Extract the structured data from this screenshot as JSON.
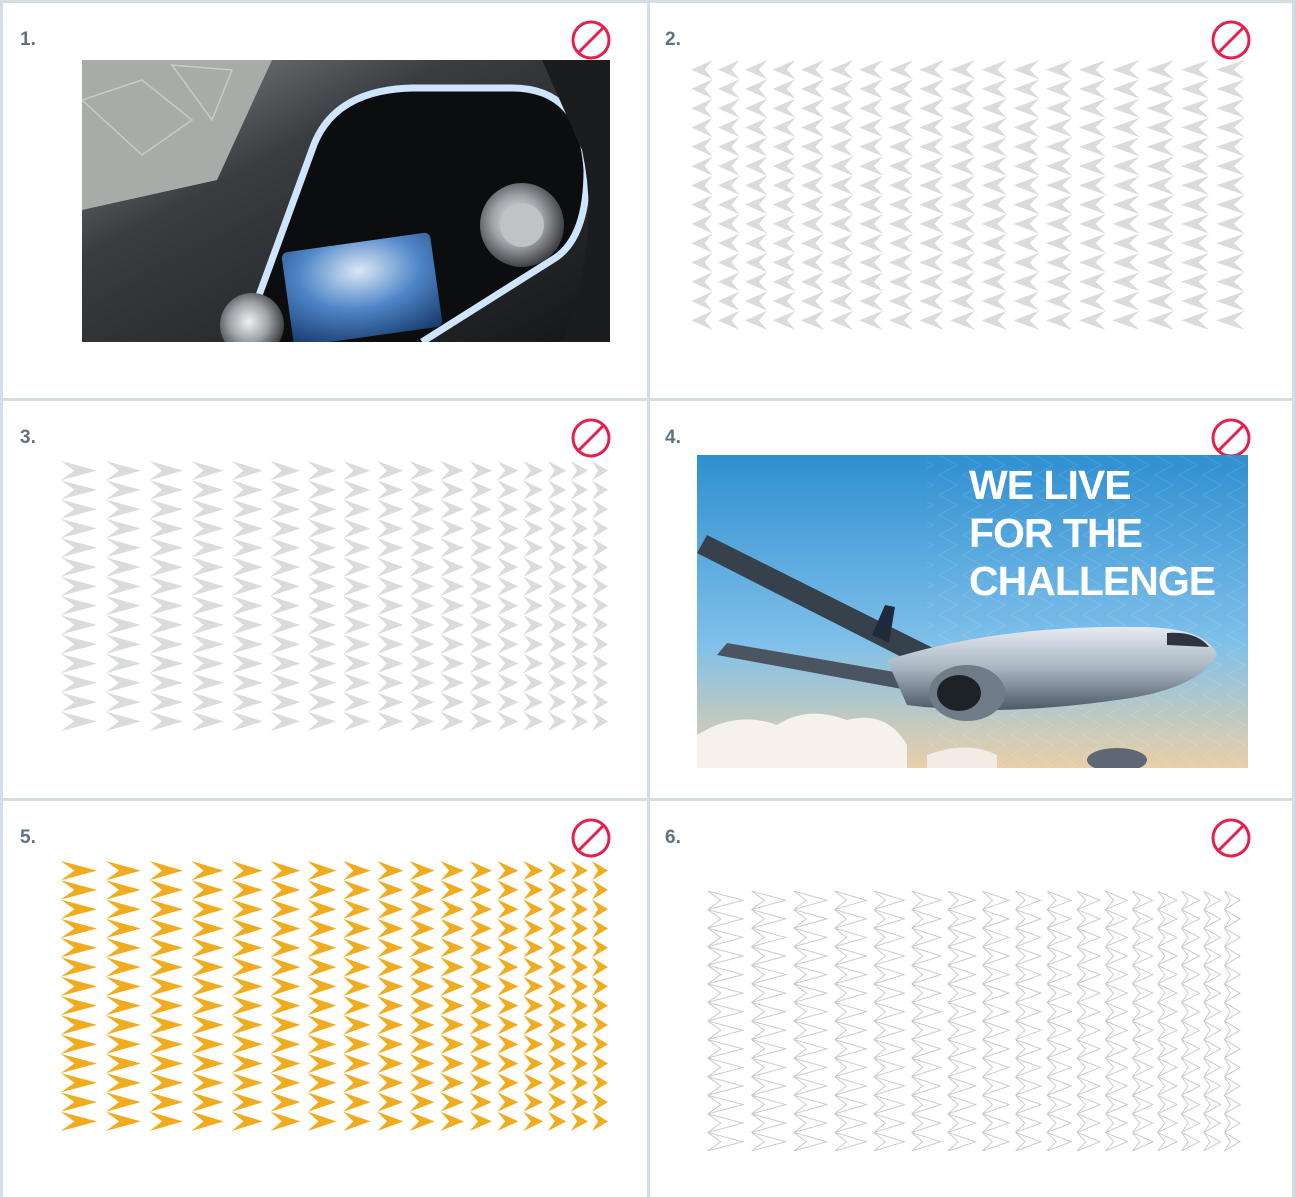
{
  "panels": [
    {
      "number": "1.",
      "content": "photo",
      "icon": "prohibited-icon"
    },
    {
      "number": "2.",
      "content": "pattern-pointing-left",
      "icon": "prohibited-icon",
      "pattern_color": "#d9dbdd",
      "pattern_style": "filled"
    },
    {
      "number": "3.",
      "content": "pattern-pointing-right",
      "icon": "prohibited-icon",
      "pattern_color": "#d9dbdd",
      "pattern_style": "filled"
    },
    {
      "number": "4.",
      "content": "photo",
      "icon": "prohibited-icon",
      "headline": [
        "WE LIVE",
        "FOR THE",
        "CHALLENGE"
      ]
    },
    {
      "number": "5.",
      "content": "pattern-pointing-right",
      "icon": "prohibited-icon",
      "pattern_color": "#f0ac1e",
      "pattern_style": "filled"
    },
    {
      "number": "6.",
      "content": "pattern-pointing-right",
      "icon": "prohibited-icon",
      "pattern_color": "#c9ccce",
      "pattern_style": "outline"
    }
  ],
  "colors": {
    "divider": "#d3dde4",
    "number_text": "#5f7385",
    "prohibited_icon": "#e5204e"
  }
}
